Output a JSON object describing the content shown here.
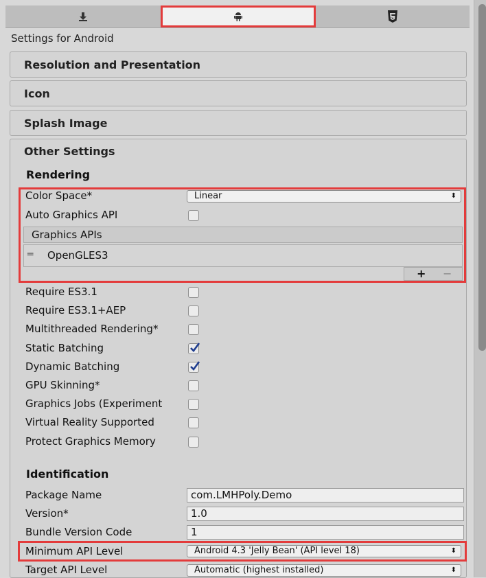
{
  "tabs": [
    {
      "icon": "download-icon"
    },
    {
      "icon": "android-icon",
      "selected": true
    },
    {
      "icon": "html5-icon"
    }
  ],
  "header": "Settings for Android",
  "sections": {
    "resolution": "Resolution and Presentation",
    "icon": "Icon",
    "splash": "Splash Image",
    "other": "Other Settings"
  },
  "rendering": {
    "title": "Rendering",
    "color_space_label": "Color Space*",
    "color_space_value": "Linear",
    "auto_graphics_label": "Auto Graphics API",
    "auto_graphics_checked": false,
    "graphics_apis_label": "Graphics APIs",
    "graphics_api_item": "OpenGLES3",
    "add": "+",
    "remove": "−"
  },
  "options": [
    {
      "label": "Require ES3.1",
      "checked": false
    },
    {
      "label": "Require ES3.1+AEP",
      "checked": false
    },
    {
      "label": "Multithreaded Rendering*",
      "checked": false
    },
    {
      "label": "Static Batching",
      "checked": true
    },
    {
      "label": "Dynamic Batching",
      "checked": true
    },
    {
      "label": "GPU Skinning*",
      "checked": false
    },
    {
      "label": "Graphics Jobs (Experiment",
      "checked": false
    },
    {
      "label": "Virtual Reality Supported",
      "checked": false
    },
    {
      "label": "Protect Graphics Memory",
      "checked": false
    }
  ],
  "identification": {
    "title": "Identification",
    "package_name_label": "Package Name",
    "package_name_value": "com.LMHPoly.Demo",
    "version_label": "Version*",
    "version_value": "1.0",
    "bundle_label": "Bundle Version Code",
    "bundle_value": "1",
    "min_api_label": "Minimum API Level",
    "min_api_value": "Android 4.3 'Jelly Bean' (API level 18)",
    "target_api_label": "Target API Level",
    "target_api_value": "Automatic (highest installed)"
  },
  "colors": {
    "highlight": "#e33b3b",
    "check": "#1f3d8f"
  }
}
